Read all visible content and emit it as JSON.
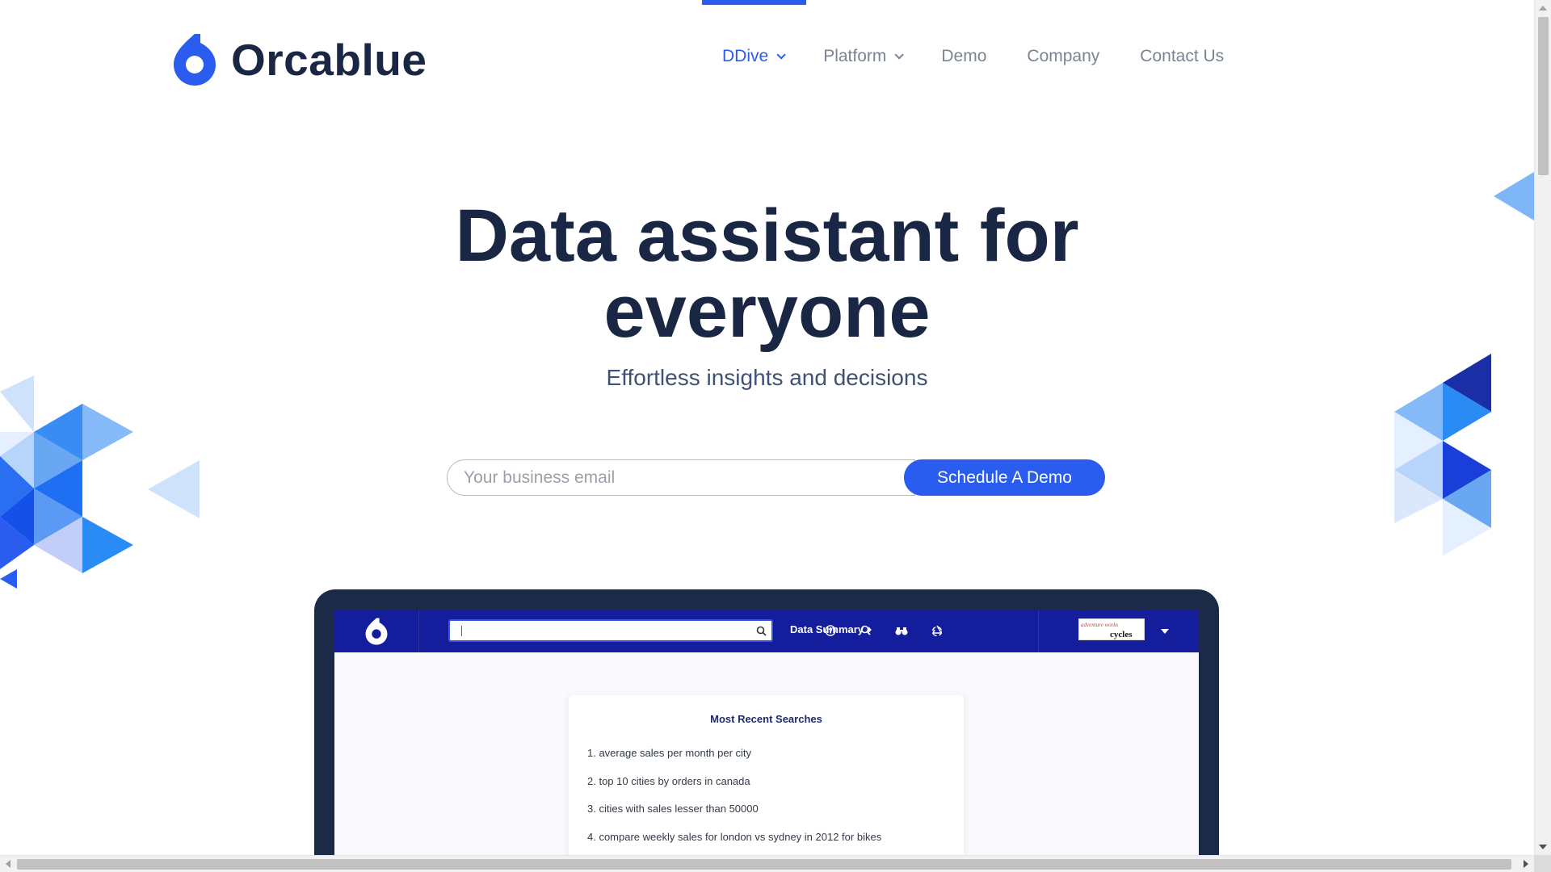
{
  "brand": {
    "name": "Orcablue",
    "color": "#2a5cf0"
  },
  "nav": {
    "items": [
      {
        "label": "DDive",
        "active": true,
        "has_dropdown": true
      },
      {
        "label": "Platform",
        "active": false,
        "has_dropdown": true
      },
      {
        "label": "Demo",
        "active": false,
        "has_dropdown": false
      },
      {
        "label": "Company",
        "active": false,
        "has_dropdown": false
      },
      {
        "label": "Contact Us",
        "active": false,
        "has_dropdown": false
      }
    ]
  },
  "hero": {
    "title_line1": "Data assistant for",
    "title_line2": "everyone",
    "subtitle": "Effortless insights and decisions"
  },
  "signup": {
    "email_placeholder": "Your business email",
    "email_value": "",
    "cta_label": "Schedule A Demo"
  },
  "app_preview": {
    "bar_color": "#141e9c",
    "search_value": "",
    "summary_label": "Data Summary",
    "icons": [
      "help-icon",
      "search-icon",
      "binoculars-icon",
      "recycle-icon"
    ],
    "brand_logo_small": "adventure works",
    "brand_logo_big": "cycles",
    "recent": {
      "title": "Most Recent Searches",
      "items": [
        "1. average sales per month per city",
        "2. top 10 cities by orders in canada",
        "3. cities with sales lesser than 50000",
        "4. compare weekly sales for london vs sydney in 2012 for bikes"
      ]
    }
  }
}
